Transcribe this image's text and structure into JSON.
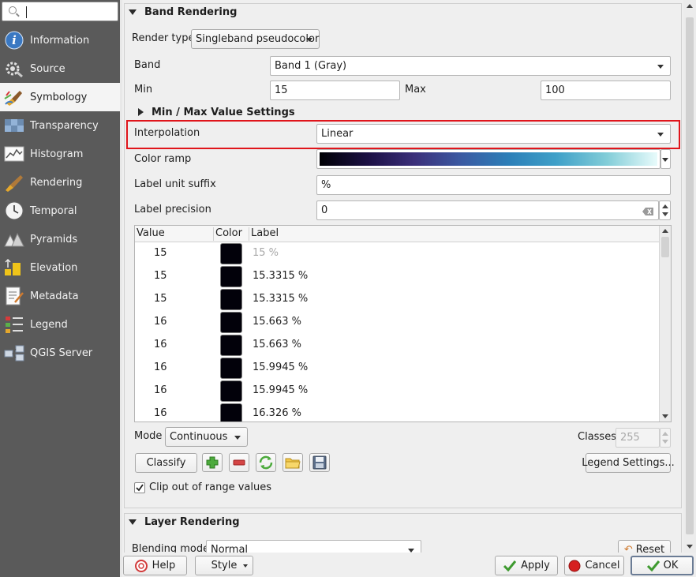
{
  "sidebar": {
    "search_placeholder": "",
    "items": [
      {
        "label": "Information",
        "icon": "info-icon"
      },
      {
        "label": "Source",
        "icon": "source-icon"
      },
      {
        "label": "Symbology",
        "icon": "paintbrush-icon",
        "active": true
      },
      {
        "label": "Transparency",
        "icon": "transparency-icon"
      },
      {
        "label": "Histogram",
        "icon": "histogram-icon"
      },
      {
        "label": "Rendering",
        "icon": "rendering-brush-icon"
      },
      {
        "label": "Temporal",
        "icon": "clock-icon"
      },
      {
        "label": "Pyramids",
        "icon": "pyramids-icon"
      },
      {
        "label": "Elevation",
        "icon": "elevation-icon"
      },
      {
        "label": "Metadata",
        "icon": "metadata-icon"
      },
      {
        "label": "Legend",
        "icon": "legend-icon"
      },
      {
        "label": "QGIS Server",
        "icon": "qgis-server-icon"
      }
    ]
  },
  "band_rendering": {
    "title": "Band Rendering",
    "render_type_label": "Render type",
    "render_type_value": "Singleband pseudocolor",
    "band_label": "Band",
    "band_value": "Band 1 (Gray)",
    "min_label": "Min",
    "min_value": "15",
    "max_label": "Max",
    "max_value": "100",
    "minmax_settings_label": "Min / Max Value Settings",
    "interpolation_label": "Interpolation",
    "interpolation_value": "Linear",
    "color_ramp_label": "Color ramp",
    "label_unit_suffix_label": "Label unit suffix",
    "label_unit_suffix_value": "%",
    "label_precision_label": "Label precision",
    "label_precision_value": "0",
    "table": {
      "headers": [
        "Value",
        "Color",
        "Label"
      ],
      "rows": [
        {
          "value": "15",
          "label": "15 %",
          "muted": true
        },
        {
          "value": "15",
          "label": "15.3315 %"
        },
        {
          "value": "15",
          "label": "15.3315 %"
        },
        {
          "value": "16",
          "label": "15.663 %"
        },
        {
          "value": "16",
          "label": "15.663 %"
        },
        {
          "value": "16",
          "label": "15.9945 %"
        },
        {
          "value": "16",
          "label": "15.9945 %"
        },
        {
          "value": "16",
          "label": "16.326 %"
        }
      ]
    },
    "mode_label": "Mode",
    "mode_value": "Continuous",
    "classes_label": "Classes",
    "classes_value": "255",
    "classify_label": "Classify",
    "legend_settings_label": "Legend Settings...",
    "clip_label": "Clip out of range values",
    "clip_checked": true
  },
  "layer_rendering": {
    "title": "Layer Rendering",
    "blending_label": "Blending mode",
    "blending_value": "Normal",
    "reset_label": "Reset"
  },
  "footer": {
    "help_label": "Help",
    "style_label": "Style",
    "apply_label": "Apply",
    "cancel_label": "Cancel",
    "ok_label": "OK"
  },
  "colors": {
    "highlight_box": "#e0151b",
    "ramp_start": "#000004",
    "ramp_end": "#e8fbfb"
  }
}
